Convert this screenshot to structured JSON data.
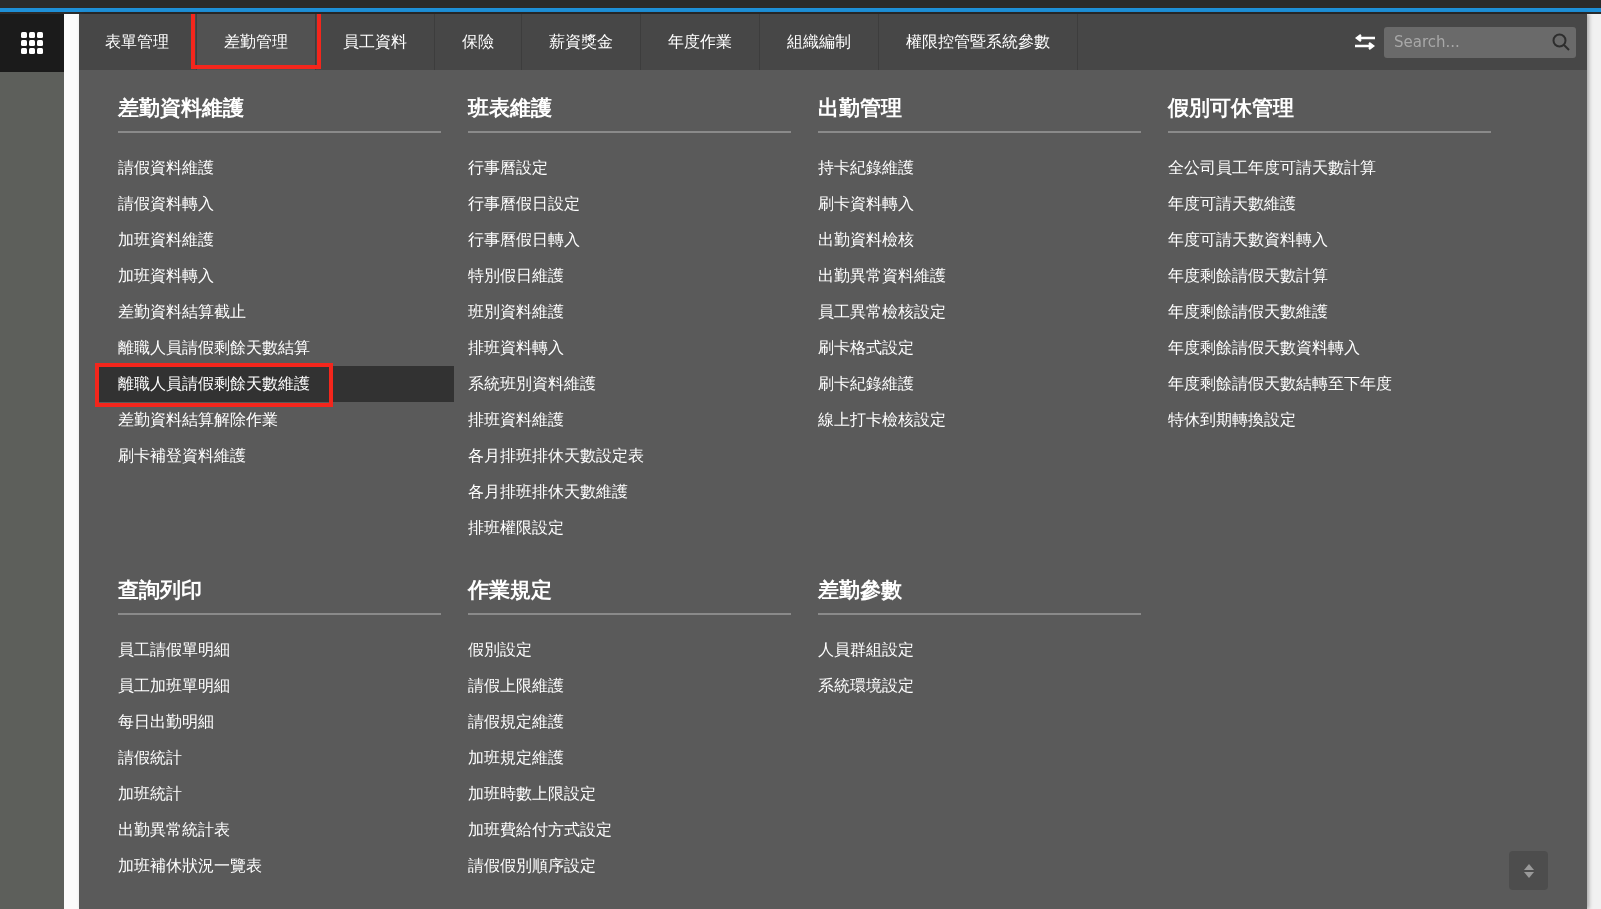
{
  "nav": {
    "tabs": [
      {
        "label": "表單管理",
        "selected": false,
        "annotated": false
      },
      {
        "label": "差勤管理",
        "selected": true,
        "annotated": true
      },
      {
        "label": "員工資料",
        "selected": false,
        "annotated": false
      },
      {
        "label": "保險",
        "selected": false,
        "annotated": false
      },
      {
        "label": "薪資獎金",
        "selected": false,
        "annotated": false
      },
      {
        "label": "年度作業",
        "selected": false,
        "annotated": false
      },
      {
        "label": "組織編制",
        "selected": false,
        "annotated": false
      },
      {
        "label": "權限控管暨系統參數",
        "selected": false,
        "annotated": false
      }
    ],
    "search": {
      "placeholder": "Search..."
    }
  },
  "sections": [
    {
      "title": "差勤資料維護",
      "items": [
        {
          "label": "請假資料維護",
          "selected": false,
          "annotated": false
        },
        {
          "label": "請假資料轉入",
          "selected": false,
          "annotated": false
        },
        {
          "label": "加班資料維護",
          "selected": false,
          "annotated": false
        },
        {
          "label": "加班資料轉入",
          "selected": false,
          "annotated": false
        },
        {
          "label": "差勤資料結算截止",
          "selected": false,
          "annotated": false
        },
        {
          "label": "離職人員請假剩餘天數結算",
          "selected": false,
          "annotated": false
        },
        {
          "label": "離職人員請假剩餘天數維護",
          "selected": true,
          "annotated": true
        },
        {
          "label": "差勤資料結算解除作業",
          "selected": false,
          "annotated": false
        },
        {
          "label": "刷卡補登資料維護",
          "selected": false,
          "annotated": false
        }
      ]
    },
    {
      "title": "班表維護",
      "items": [
        {
          "label": "行事曆設定",
          "selected": false,
          "annotated": false
        },
        {
          "label": "行事曆假日設定",
          "selected": false,
          "annotated": false
        },
        {
          "label": "行事曆假日轉入",
          "selected": false,
          "annotated": false
        },
        {
          "label": "特別假日維護",
          "selected": false,
          "annotated": false
        },
        {
          "label": "班別資料維護",
          "selected": false,
          "annotated": false
        },
        {
          "label": "排班資料轉入",
          "selected": false,
          "annotated": false
        },
        {
          "label": "系統班別資料維護",
          "selected": false,
          "annotated": false
        },
        {
          "label": "排班資料維護",
          "selected": false,
          "annotated": false
        },
        {
          "label": "各月排班排休天數設定表",
          "selected": false,
          "annotated": false
        },
        {
          "label": "各月排班排休天數維護",
          "selected": false,
          "annotated": false
        },
        {
          "label": "排班權限設定",
          "selected": false,
          "annotated": false
        }
      ]
    },
    {
      "title": "出勤管理",
      "items": [
        {
          "label": "持卡紀錄維護",
          "selected": false,
          "annotated": false
        },
        {
          "label": "刷卡資料轉入",
          "selected": false,
          "annotated": false
        },
        {
          "label": "出勤資料檢核",
          "selected": false,
          "annotated": false
        },
        {
          "label": "出勤異常資料維護",
          "selected": false,
          "annotated": false
        },
        {
          "label": "員工異常檢核設定",
          "selected": false,
          "annotated": false
        },
        {
          "label": "刷卡格式設定",
          "selected": false,
          "annotated": false
        },
        {
          "label": "刷卡紀錄維護",
          "selected": false,
          "annotated": false
        },
        {
          "label": "線上打卡檢核設定",
          "selected": false,
          "annotated": false
        }
      ]
    },
    {
      "title": "假別可休管理",
      "items": [
        {
          "label": "全公司員工年度可請天數計算",
          "selected": false,
          "annotated": false
        },
        {
          "label": "年度可請天數維護",
          "selected": false,
          "annotated": false
        },
        {
          "label": "年度可請天數資料轉入",
          "selected": false,
          "annotated": false
        },
        {
          "label": "年度剩餘請假天數計算",
          "selected": false,
          "annotated": false
        },
        {
          "label": "年度剩餘請假天數維護",
          "selected": false,
          "annotated": false
        },
        {
          "label": "年度剩餘請假天數資料轉入",
          "selected": false,
          "annotated": false
        },
        {
          "label": "年度剩餘請假天數結轉至下年度",
          "selected": false,
          "annotated": false
        },
        {
          "label": "特休到期轉換設定",
          "selected": false,
          "annotated": false
        }
      ]
    },
    {
      "title": "查詢列印",
      "items": [
        {
          "label": "員工請假單明細",
          "selected": false,
          "annotated": false
        },
        {
          "label": "員工加班單明細",
          "selected": false,
          "annotated": false
        },
        {
          "label": "每日出勤明細",
          "selected": false,
          "annotated": false
        },
        {
          "label": "請假統計",
          "selected": false,
          "annotated": false
        },
        {
          "label": "加班統計",
          "selected": false,
          "annotated": false
        },
        {
          "label": "出勤異常統計表",
          "selected": false,
          "annotated": false
        },
        {
          "label": "加班補休狀況一覽表",
          "selected": false,
          "annotated": false
        }
      ]
    },
    {
      "title": "作業規定",
      "items": [
        {
          "label": "假別設定",
          "selected": false,
          "annotated": false
        },
        {
          "label": "請假上限維護",
          "selected": false,
          "annotated": false
        },
        {
          "label": "請假規定維護",
          "selected": false,
          "annotated": false
        },
        {
          "label": "加班規定維護",
          "selected": false,
          "annotated": false
        },
        {
          "label": "加班時數上限設定",
          "selected": false,
          "annotated": false
        },
        {
          "label": "加班費給付方式設定",
          "selected": false,
          "annotated": false
        },
        {
          "label": "請假假別順序設定",
          "selected": false,
          "annotated": false
        }
      ]
    },
    {
      "title": "差勤參數",
      "items": [
        {
          "label": "人員群組設定",
          "selected": false,
          "annotated": false
        },
        {
          "label": "系統環境設定",
          "selected": false,
          "annotated": false
        }
      ]
    }
  ]
}
